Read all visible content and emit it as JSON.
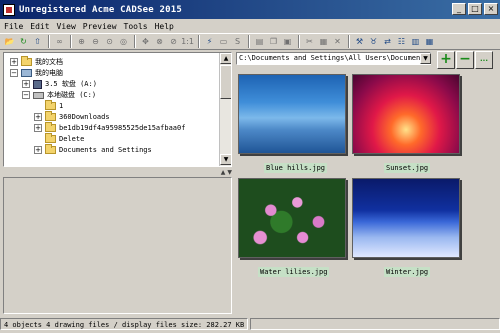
{
  "window": {
    "title": "Unregistered Acme CADSee 2015",
    "minimize_glyph": "_",
    "maximize_glyph": "□",
    "close_glyph": "×"
  },
  "menu": [
    "File",
    "Edit",
    "View",
    "Preview",
    "Tools",
    "Help"
  ],
  "toolbar": {
    "group1": [
      "open-folder-icon",
      "refresh-icon",
      "folder-up-icon"
    ],
    "group2": [
      "binoculars-icon"
    ],
    "group3": [
      "zoom-in-icon",
      "zoom-out-icon",
      "zoom-window-icon",
      "zoom-previous-icon"
    ],
    "group4": [
      "pan-icon",
      "zoom-extents-icon",
      "zoom-fit-icon",
      "zoom-real-icon"
    ],
    "zoom_label": "1:1",
    "group5": [
      "pointer-icon",
      "measure-icon",
      "text-icon"
    ],
    "group6": [
      "layers-icon",
      "copy-icon",
      "print-icon"
    ],
    "group7": [
      "cut-icon",
      "paste-icon",
      "delete-icon"
    ],
    "group8": [
      "options-icon",
      "filter-icon",
      "convert-icon",
      "properties-icon",
      "grid-icon",
      "thumbnails-icon"
    ]
  },
  "tree": {
    "items": [
      {
        "label": "我的文档",
        "icon": "folder-icon",
        "expander": "+"
      },
      {
        "label": "我的电脑",
        "icon": "computer-icon",
        "expander": "−"
      },
      {
        "label": "3.5 软盘 (A:)",
        "icon": "floppy-icon",
        "expander": "+"
      },
      {
        "label": "本地磁盘 (C:)",
        "icon": "drive-icon",
        "expander": "−"
      },
      {
        "label": "1",
        "icon": "folder-icon",
        "expander": ""
      },
      {
        "label": "360Downloads",
        "icon": "folder-icon",
        "expander": "+"
      },
      {
        "label": "be1db19df4a95985525de15afbaa0f",
        "icon": "folder-icon",
        "expander": "+"
      },
      {
        "label": "Delete",
        "icon": "folder-icon",
        "expander": ""
      },
      {
        "label": "Documents and Settings",
        "icon": "folder-icon",
        "expander": "+"
      }
    ]
  },
  "path": {
    "value": "C:\\Documents and Settings\\All Users\\Documents\\",
    "dropdown_glyph": "▼",
    "add_label": "+",
    "remove_label": "−",
    "more_label": "..."
  },
  "thumbnails": [
    {
      "label": "Blue hills.jpg",
      "image": "blue-hills"
    },
    {
      "label": "Sunset.jpg",
      "image": "sunset"
    },
    {
      "label": "Water lilies.jpg",
      "image": "water-lilies"
    },
    {
      "label": "Winter.jpg",
      "image": "winter"
    }
  ],
  "status": {
    "text": "4 objects 4 drawing files / display files size: 282.27 KB"
  },
  "scroll": {
    "up": "▲",
    "down": "▼"
  }
}
